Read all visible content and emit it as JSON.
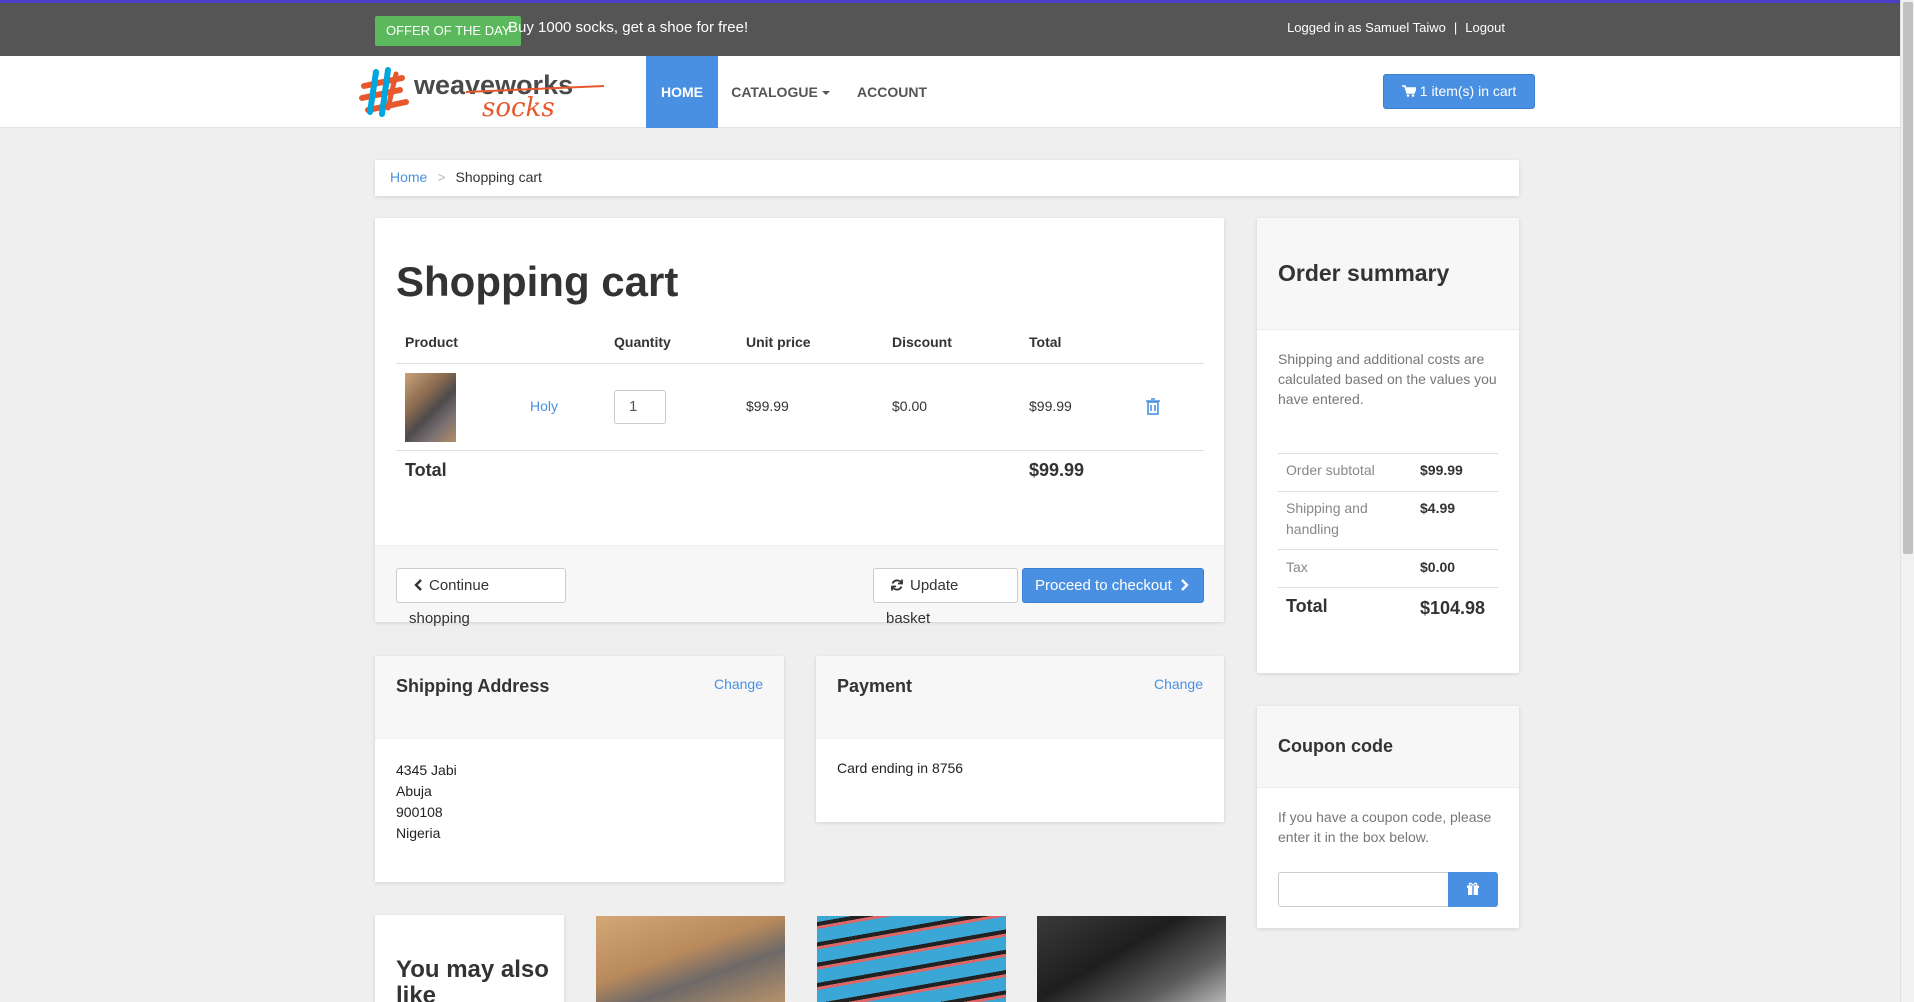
{
  "topbar": {
    "offer_badge": "OFFER OF THE DAY",
    "offer_text": "Buy 1000 socks, get a shoe for free!",
    "logged_in_text": "Logged in as Samuel Taiwo",
    "separator": "|",
    "logout_label": "Logout"
  },
  "logo": {
    "brand": "weaveworks",
    "sub": "socks"
  },
  "nav": {
    "home": "HOME",
    "catalogue": "CATALOGUE",
    "account": "ACCOUNT",
    "cart_button": "1 item(s) in cart"
  },
  "breadcrumb": {
    "home": "Home",
    "separator": ">",
    "current": "Shopping cart"
  },
  "cart": {
    "title": "Shopping cart",
    "headers": {
      "product": "Product",
      "quantity": "Quantity",
      "unit_price": "Unit price",
      "discount": "Discount",
      "total": "Total"
    },
    "items": [
      {
        "name": "Holy",
        "quantity": "1",
        "unit_price": "$99.99",
        "discount": "$0.00",
        "total": "$99.99"
      }
    ],
    "total_label": "Total",
    "total_value": "$99.99",
    "continue_label": "Continue shopping",
    "update_label": "Update basket",
    "checkout_label": "Proceed to checkout"
  },
  "summary": {
    "title": "Order summary",
    "description": "Shipping and additional costs are calculated based on the values you have entered.",
    "rows": [
      {
        "label": "Order subtotal",
        "value": "$99.99"
      },
      {
        "label": "Shipping and handling",
        "value": "$4.99"
      },
      {
        "label": "Tax",
        "value": "$0.00"
      }
    ],
    "total_label": "Total",
    "total_value": "$104.98"
  },
  "coupon": {
    "title": "Coupon code",
    "description": "If you have a coupon code, please enter it in the box below.",
    "input_value": ""
  },
  "shipping": {
    "title": "Shipping Address",
    "change_label": "Change",
    "lines": [
      "4345 Jabi",
      "Abuja",
      "900108",
      "Nigeria"
    ]
  },
  "payment": {
    "title": "Payment",
    "change_label": "Change",
    "card_text": "Card ending in 8756"
  },
  "recommendations": {
    "title": "You may also like"
  },
  "colors": {
    "primary": "#4a90e2",
    "offer_green": "#5cb85c",
    "topbar": "#555555"
  }
}
